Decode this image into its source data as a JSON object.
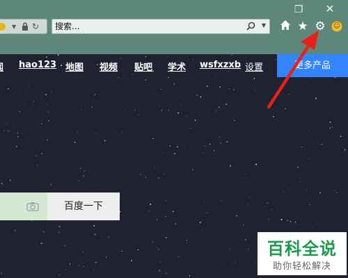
{
  "toolbar": {
    "search_placeholder": "搜索..."
  },
  "nav": {
    "items": [
      {
        "label": "闻"
      },
      {
        "label": "hao123"
      },
      {
        "label": "地图"
      },
      {
        "label": "视频"
      },
      {
        "label": "贴吧"
      },
      {
        "label": "学术"
      },
      {
        "label": "wsfxzxb"
      },
      {
        "label": "设置"
      }
    ],
    "more_label": "更多产品"
  },
  "search": {
    "submit_label": "百度一下"
  },
  "watermark": {
    "title": "百科全说",
    "subtitle": "助你轻松解决"
  },
  "colors": {
    "chrome": "#5e877c",
    "accent": "#3385ff",
    "annotation_arrow": "#e8201a",
    "watermark_green": "#1a9b4b"
  },
  "icons": [
    "restore-icon",
    "close-icon",
    "lock-icon",
    "refresh-icon",
    "search-icon",
    "home-icon",
    "favorites-star-icon",
    "gear-icon",
    "smiley-icon",
    "camera-icon"
  ]
}
